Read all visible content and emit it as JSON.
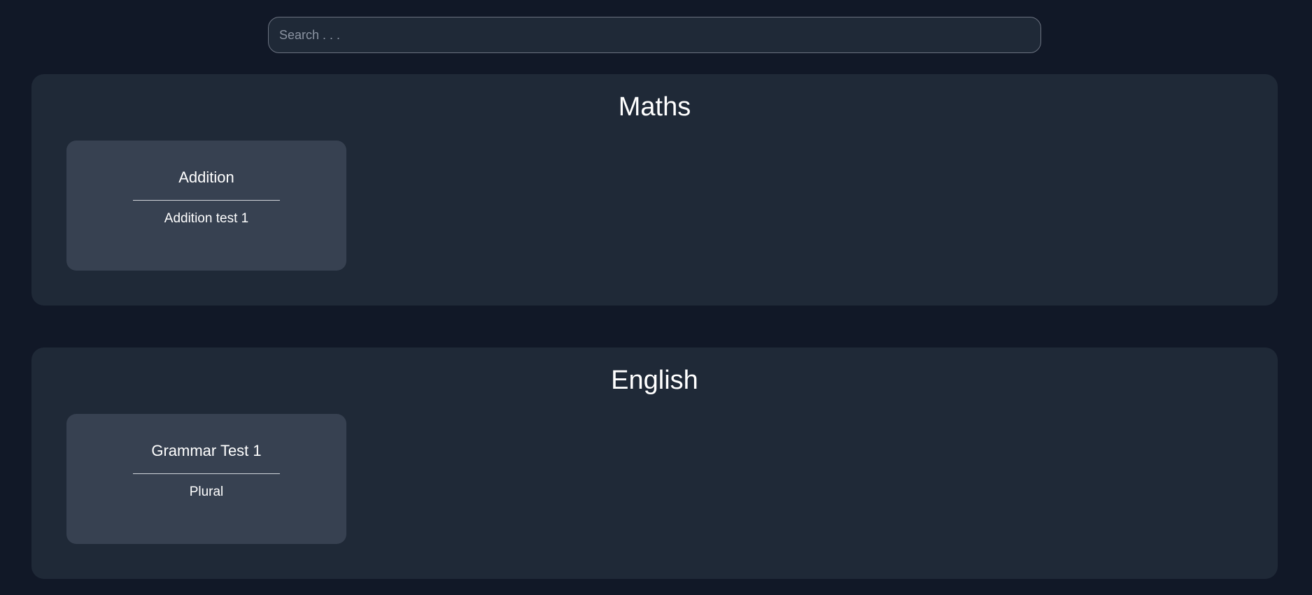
{
  "search": {
    "placeholder": "Search . . ."
  },
  "sections": [
    {
      "title": "Maths",
      "cards": [
        {
          "title": "Addition",
          "subtitle": "Addition test 1"
        }
      ]
    },
    {
      "title": "English",
      "cards": [
        {
          "title": "Grammar Test 1",
          "subtitle": "Plural"
        }
      ]
    }
  ],
  "colors": {
    "background": "#111827",
    "section": "#1f2937",
    "card": "#374151",
    "text": "#ffffff"
  }
}
